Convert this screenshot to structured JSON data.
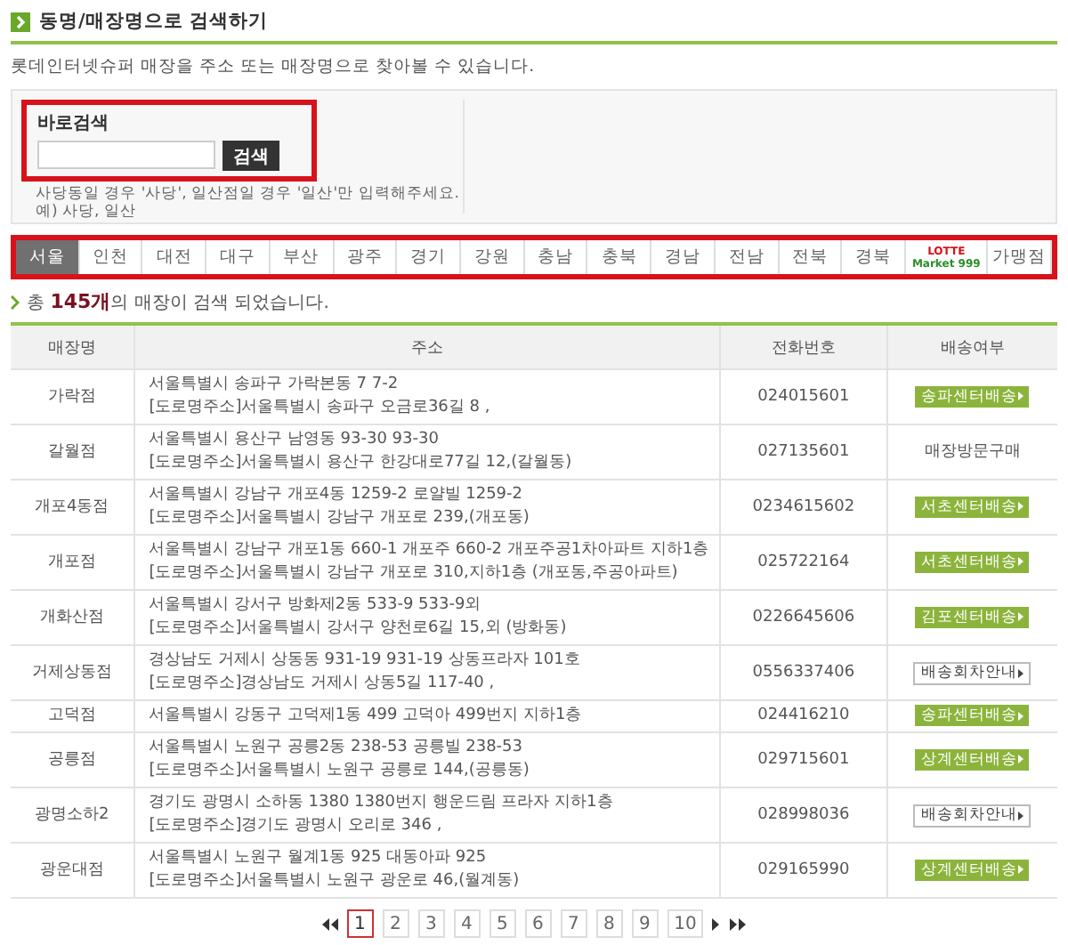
{
  "section_title": "동명/매장명으로 검색하기",
  "intro": "롯데인터넷슈퍼 매장을 주소 또는 매장명으로 찾아볼 수 있습니다.",
  "search": {
    "label": "바로검색",
    "button": "검색",
    "hint_lines": [
      "사당동일 경우 '사당', 일산점일 경우 '일산'만 입력해주세요.",
      "예) 사당, 일산"
    ]
  },
  "tabs": [
    {
      "label": "서울",
      "kind": "text",
      "selected": true
    },
    {
      "label": "인천",
      "kind": "text",
      "selected": false
    },
    {
      "label": "대전",
      "kind": "text",
      "selected": false
    },
    {
      "label": "대구",
      "kind": "text",
      "selected": false
    },
    {
      "label": "부산",
      "kind": "text",
      "selected": false
    },
    {
      "label": "광주",
      "kind": "text",
      "selected": false
    },
    {
      "label": "경기",
      "kind": "text",
      "selected": false
    },
    {
      "label": "강원",
      "kind": "text",
      "selected": false
    },
    {
      "label": "충남",
      "kind": "text",
      "selected": false
    },
    {
      "label": "충북",
      "kind": "text",
      "selected": false
    },
    {
      "label": "경남",
      "kind": "text",
      "selected": false
    },
    {
      "label": "전남",
      "kind": "text",
      "selected": false
    },
    {
      "label": "전북",
      "kind": "text",
      "selected": false
    },
    {
      "label": "경북",
      "kind": "text",
      "selected": false
    },
    {
      "label": "LOTTE Market 999",
      "kind": "logo",
      "selected": false
    },
    {
      "label": "가맹점",
      "kind": "text",
      "selected": false
    }
  ],
  "result": {
    "prefix": "총",
    "count": "145개",
    "suffix": "의 매장이 검색 되었습니다."
  },
  "table": {
    "columns": [
      "매장명",
      "주소",
      "전화번호",
      "배송여부"
    ],
    "rows": [
      {
        "name": "가락점",
        "address": [
          "서울특별시 송파구 가락본동 7  7-2",
          "[도로명주소]서울특별시 송파구 오금로36길 8 ,"
        ],
        "phone": "024015601",
        "delivery": {
          "kind": "center",
          "label": "송파센터배송"
        }
      },
      {
        "name": "갈월점",
        "address": [
          "서울특별시 용산구 남영동 93-30 93-30",
          "[도로명주소]서울특별시 용산구 한강대로77길 12,(갈월동)"
        ],
        "phone": "027135601",
        "delivery": {
          "kind": "visit",
          "label": "매장방문구매"
        }
      },
      {
        "name": "개포4동점",
        "address": [
          "서울특별시 강남구 개포4동 1259-2 로얄빌  1259-2",
          "[도로명주소]서울특별시 강남구 개포로 239,(개포동)"
        ],
        "phone": "0234615602",
        "delivery": {
          "kind": "center",
          "label": "서초센터배송"
        }
      },
      {
        "name": "개포점",
        "address": [
          "서울특별시 강남구 개포1동 660-1 개포주  660-2 개포주공1차아파트 지하1층",
          "[도로명주소]서울특별시 강남구 개포로 310,지하1층 (개포동,주공아파트)"
        ],
        "phone": "025722164",
        "delivery": {
          "kind": "center",
          "label": "서초센터배송"
        }
      },
      {
        "name": "개화산점",
        "address": [
          "서울특별시 강서구 방화제2동 533-9  533-9외",
          "[도로명주소]서울특별시 강서구 양천로6길 15,외 (방화동)"
        ],
        "phone": "0226645606",
        "delivery": {
          "kind": "center",
          "label": "김포센터배송"
        }
      },
      {
        "name": "거제상동점",
        "address": [
          "경상남도 거제시 상동동 931-19  931-19 상동프라자 101호",
          "[도로명주소]경상남도 거제시 상동5길 117-40 ,"
        ],
        "phone": "0556337406",
        "delivery": {
          "kind": "notice",
          "label": "배송회차안내"
        }
      },
      {
        "name": "고덕점",
        "address": [
          "서울특별시 강동구 고덕제1동 499 고덕아  499번지 지하1층"
        ],
        "phone": "024416210",
        "delivery": {
          "kind": "center",
          "label": "송파센터배송"
        }
      },
      {
        "name": "공릉점",
        "address": [
          "서울특별시 노원구 공릉2동 238-53 공릉빌  238-53",
          "[도로명주소]서울특별시 노원구 공릉로 144,(공릉동)"
        ],
        "phone": "029715601",
        "delivery": {
          "kind": "center",
          "label": "상계센터배송"
        }
      },
      {
        "name": "광명소하2",
        "address": [
          "경기도 광명시 소하동 1380  1380번지 행운드림 프라자 지하1층",
          "[도로명주소]경기도 광명시 오리로 346 ,"
        ],
        "phone": "028998036",
        "delivery": {
          "kind": "notice",
          "label": "배송회차안내"
        }
      },
      {
        "name": "광운대점",
        "address": [
          "서울특별시 노원구 월계1동 925 대동아파  925",
          "[도로명주소]서울특별시 노원구 광운로 46,(월계동)"
        ],
        "phone": "029165990",
        "delivery": {
          "kind": "center",
          "label": "상계센터배송"
        }
      }
    ]
  },
  "pagination": {
    "pages": [
      {
        "label": "1",
        "selected": true
      },
      {
        "label": "2",
        "selected": false
      },
      {
        "label": "3",
        "selected": false
      },
      {
        "label": "4",
        "selected": false
      },
      {
        "label": "5",
        "selected": false
      },
      {
        "label": "6",
        "selected": false
      },
      {
        "label": "7",
        "selected": false
      },
      {
        "label": "8",
        "selected": false
      },
      {
        "label": "9",
        "selected": false
      },
      {
        "label": "10",
        "selected": false
      }
    ]
  }
}
